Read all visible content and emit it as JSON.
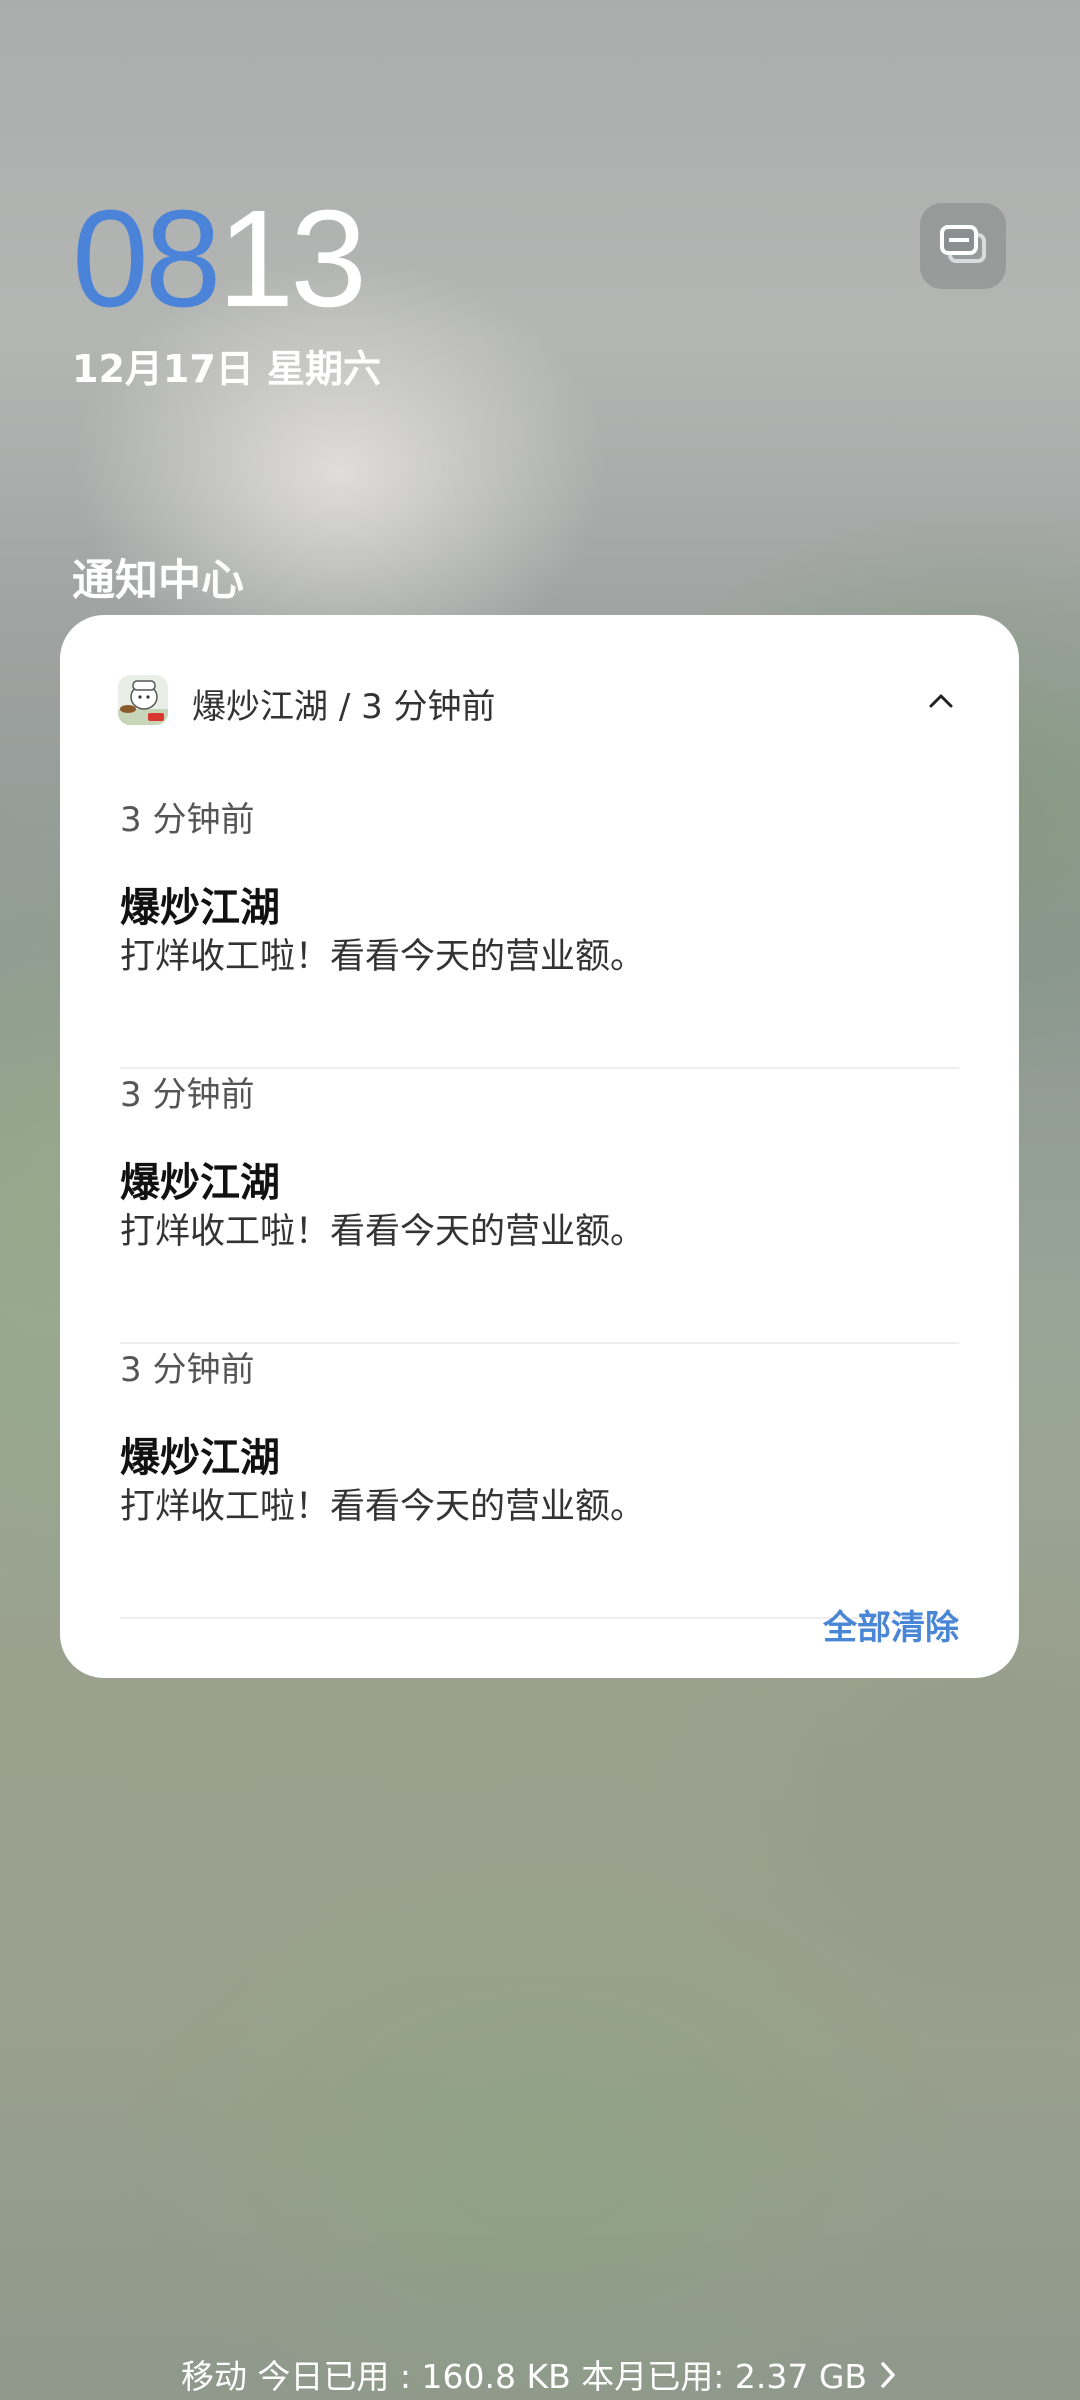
{
  "clock": {
    "hour": "08",
    "minute": "13"
  },
  "date": "12月17日 星期六",
  "notification_center": {
    "title": "通知中心",
    "group": {
      "app_name": "爆炒江湖",
      "separator": "/",
      "time": "3 分钟前",
      "notifications": [
        {
          "time": "3 分钟前",
          "title": "爆炒江湖",
          "body": "打烊收工啦！看看今天的营业额。"
        },
        {
          "time": "3 分钟前",
          "title": "爆炒江湖",
          "body": "打烊收工啦！看看今天的营业额。"
        },
        {
          "time": "3 分钟前",
          "title": "爆炒江湖",
          "body": "打烊收工啦！看看今天的营业额。"
        }
      ],
      "clear_all_label": "全部清除"
    }
  },
  "data_usage": {
    "text": "移动 今日已用 : 160.8 KB 本月已用: 2.37 GB"
  },
  "colors": {
    "clock_hour": "#4a83d8",
    "accent": "#4a86d6"
  },
  "icons": {
    "layout_toggle": "stacked-cards-icon",
    "app": "chef-app-icon",
    "collapse": "chevron-up-icon",
    "footer_arrow": "chevron-right-icon"
  }
}
